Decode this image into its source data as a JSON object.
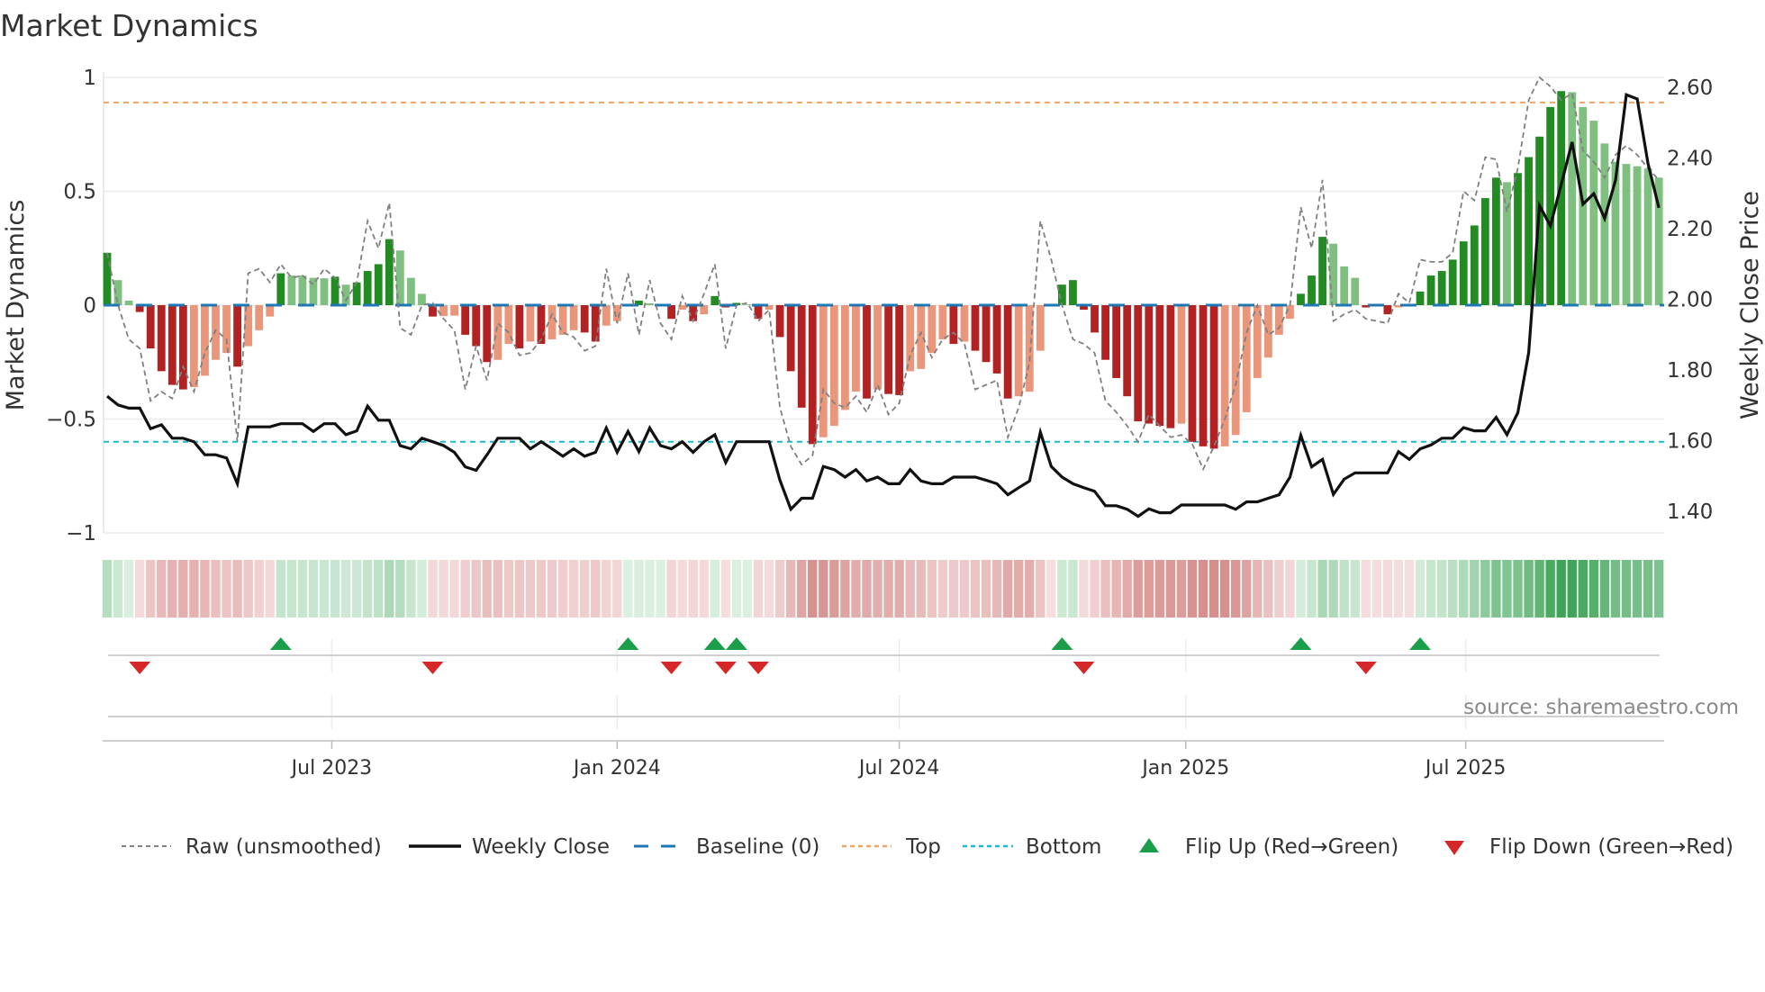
{
  "chart_data": {
    "type": "bar",
    "title": "Market Dynamics",
    "ylabel": "Market Dynamics",
    "y2label": "Weekly Close Price",
    "ylim": [
      -1,
      1
    ],
    "y2lim": [
      1.339,
      2.628
    ],
    "yticks": [
      {
        "v": 1,
        "label": "1"
      },
      {
        "v": 0.5,
        "label": "0.5"
      },
      {
        "v": 0,
        "label": "0"
      },
      {
        "v": -0.5,
        "label": "−0.5"
      },
      {
        "v": -1,
        "label": "−1"
      }
    ],
    "y2ticks": [
      {
        "v": 2.6,
        "label": "2.60"
      },
      {
        "v": 2.4,
        "label": "2.40"
      },
      {
        "v": 2.2,
        "label": "2.20"
      },
      {
        "v": 2.0,
        "label": "2.00"
      },
      {
        "v": 1.8,
        "label": "1.80"
      },
      {
        "v": 1.6,
        "label": "1.60"
      },
      {
        "v": 1.4,
        "label": "1.40"
      }
    ],
    "xticks": [
      {
        "week": 21.7,
        "label": "Jul 2023"
      },
      {
        "week": 48.0,
        "label": "Jan 2024"
      },
      {
        "week": 74.0,
        "label": "Jul 2024"
      },
      {
        "week": 100.4,
        "label": "Jan 2025"
      },
      {
        "week": 126.2,
        "label": "Jul 2025"
      }
    ],
    "top_level": 0.89,
    "bottom_level": -0.6,
    "baseline": 0,
    "smoothed": [
      0.23,
      0.11,
      0.02,
      -0.03,
      -0.19,
      -0.29,
      -0.35,
      -0.37,
      -0.36,
      -0.31,
      -0.24,
      -0.21,
      -0.27,
      -0.18,
      -0.11,
      -0.05,
      0.14,
      0.13,
      0.13,
      0.12,
      0.118,
      0.125,
      0.09,
      0.1,
      0.15,
      0.18,
      0.29,
      0.24,
      0.12,
      0.05,
      -0.05,
      -0.048,
      -0.046,
      -0.13,
      -0.18,
      -0.25,
      -0.24,
      -0.17,
      -0.19,
      -0.16,
      -0.17,
      -0.15,
      -0.13,
      -0.11,
      -0.12,
      -0.16,
      -0.09,
      -0.07,
      0.005,
      0.02,
      0.008,
      0.003,
      -0.06,
      -0.02,
      -0.07,
      -0.04,
      0.04,
      -0.01,
      0.01,
      0.003,
      -0.06,
      -0.02,
      -0.14,
      -0.29,
      -0.45,
      -0.61,
      -0.58,
      -0.53,
      -0.46,
      -0.38,
      -0.41,
      -0.37,
      -0.39,
      -0.395,
      -0.29,
      -0.28,
      -0.21,
      -0.15,
      -0.17,
      -0.16,
      -0.2,
      -0.25,
      -0.3,
      -0.41,
      -0.4,
      -0.38,
      -0.2,
      -0.002,
      0.09,
      0.11,
      -0.02,
      -0.12,
      -0.24,
      -0.32,
      -0.4,
      -0.51,
      -0.52,
      -0.53,
      -0.54,
      -0.52,
      -0.6,
      -0.62,
      -0.63,
      -0.62,
      -0.57,
      -0.47,
      -0.32,
      -0.23,
      -0.13,
      -0.06,
      0.05,
      0.13,
      0.3,
      0.27,
      0.17,
      0.12,
      -0.01,
      -0.005,
      -0.04,
      -0.01,
      -0.003,
      0.06,
      0.13,
      0.15,
      0.2,
      0.28,
      0.35,
      0.47,
      0.56,
      0.54,
      0.58,
      0.65,
      0.74,
      0.87,
      0.94,
      0.935,
      0.87,
      0.81,
      0.71,
      0.63,
      0.62,
      0.61,
      0.6,
      0.56
    ],
    "raw": [
      0.23,
      0.0,
      -0.15,
      -0.19,
      -0.42,
      -0.38,
      -0.41,
      -0.27,
      -0.38,
      -0.21,
      -0.11,
      -0.15,
      -0.6,
      0.14,
      0.16,
      0.1,
      0.18,
      0.12,
      0.13,
      0.09,
      0.16,
      0.12,
      0.02,
      0.1,
      0.37,
      0.25,
      0.45,
      -0.1,
      -0.13,
      0.0,
      0.01,
      -0.06,
      -0.11,
      -0.37,
      -0.18,
      -0.33,
      -0.08,
      -0.12,
      -0.22,
      -0.21,
      -0.15,
      -0.04,
      -0.12,
      -0.14,
      -0.2,
      -0.18,
      0.16,
      -0.08,
      0.14,
      -0.13,
      0.11,
      -0.08,
      -0.15,
      0.04,
      -0.07,
      0.05,
      0.18,
      -0.19,
      0.0,
      0.01,
      -0.07,
      -0.02,
      -0.45,
      -0.62,
      -0.7,
      -0.66,
      -0.37,
      -0.43,
      -0.45,
      -0.4,
      -0.47,
      -0.35,
      -0.48,
      -0.43,
      -0.22,
      -0.12,
      -0.23,
      -0.15,
      -0.12,
      -0.17,
      -0.37,
      -0.35,
      -0.33,
      -0.58,
      -0.45,
      -0.25,
      0.37,
      0.2,
      0.0,
      -0.15,
      -0.17,
      -0.21,
      -0.42,
      -0.47,
      -0.53,
      -0.6,
      -0.48,
      -0.53,
      -0.58,
      -0.57,
      -0.61,
      -0.72,
      -0.62,
      -0.5,
      -0.35,
      -0.12,
      0.0,
      -0.13,
      -0.1,
      0.0,
      0.43,
      0.25,
      0.55,
      -0.07,
      -0.04,
      -0.02,
      -0.06,
      -0.07,
      -0.08,
      0.05,
      0.01,
      0.2,
      0.19,
      0.19,
      0.23,
      0.5,
      0.46,
      0.65,
      0.64,
      0.41,
      0.6,
      0.9,
      1.0,
      0.96,
      0.9,
      0.93,
      0.68,
      0.63,
      0.56,
      0.66,
      0.7,
      0.66,
      0.6,
      0.55
    ],
    "weekly_close": [
      1.726,
      1.701,
      1.692,
      1.692,
      1.634,
      1.645,
      1.607,
      1.607,
      1.597,
      1.56,
      1.56,
      1.551,
      1.478,
      1.639,
      1.639,
      1.639,
      1.648,
      1.648,
      1.648,
      1.626,
      1.648,
      1.648,
      1.617,
      1.628,
      1.698,
      1.658,
      1.658,
      1.586,
      1.577,
      1.607,
      1.597,
      1.586,
      1.567,
      1.526,
      1.516,
      1.56,
      1.607,
      1.607,
      1.607,
      1.577,
      1.597,
      1.577,
      1.556,
      1.577,
      1.556,
      1.567,
      1.636,
      1.567,
      1.626,
      1.569,
      1.636,
      1.586,
      1.577,
      1.597,
      1.567,
      1.597,
      1.617,
      1.538,
      1.597,
      1.597,
      1.597,
      1.597,
      1.488,
      1.406,
      1.437,
      1.437,
      1.527,
      1.518,
      1.497,
      1.518,
      1.486,
      1.497,
      1.478,
      1.478,
      1.518,
      1.486,
      1.478,
      1.478,
      1.497,
      1.497,
      1.497,
      1.488,
      1.478,
      1.447,
      1.467,
      1.486,
      1.624,
      1.527,
      1.497,
      1.478,
      1.467,
      1.457,
      1.416,
      1.416,
      1.406,
      1.386,
      1.407,
      1.396,
      1.396,
      1.418,
      1.418,
      1.418,
      1.418,
      1.418,
      1.406,
      1.427,
      1.427,
      1.437,
      1.447,
      1.497,
      1.615,
      1.526,
      1.547,
      1.448,
      1.491,
      1.509,
      1.509,
      1.509,
      1.509,
      1.569,
      1.547,
      1.577,
      1.588,
      1.607,
      1.607,
      1.637,
      1.628,
      1.628,
      1.666,
      1.617,
      1.679,
      1.849,
      2.265,
      2.208,
      2.325,
      2.445,
      2.269,
      2.299,
      2.229,
      2.337,
      2.579,
      2.567,
      2.384,
      2.259
    ],
    "flip_up_weeks": [
      17,
      49,
      57,
      59,
      89,
      111,
      122
    ],
    "flip_down_weeks": [
      4,
      31,
      53,
      58,
      61,
      91,
      117
    ],
    "legend": {
      "placement": "bottom",
      "raw": "Raw (unsmoothed)",
      "close": "Weekly Close",
      "baseline": "Baseline (0)",
      "top": "Top",
      "bottom": "Bottom",
      "flip_up": "Flip Up (Red→Green)",
      "flip_down": "Flip Down (Green→Red)"
    },
    "source": "source: sharemaestro.com"
  },
  "colors": {
    "green_strong": "#228b22",
    "green_weak": "#7fbf7f",
    "red_strong": "#b22222",
    "red_weak": "#e9967a",
    "baseline": "#1f77b4",
    "top": "#f4a460",
    "bottom": "#17becf",
    "raw": "#808080",
    "close": "#111111",
    "flip_up": "#1a9e4a",
    "flip_down": "#d62728"
  }
}
